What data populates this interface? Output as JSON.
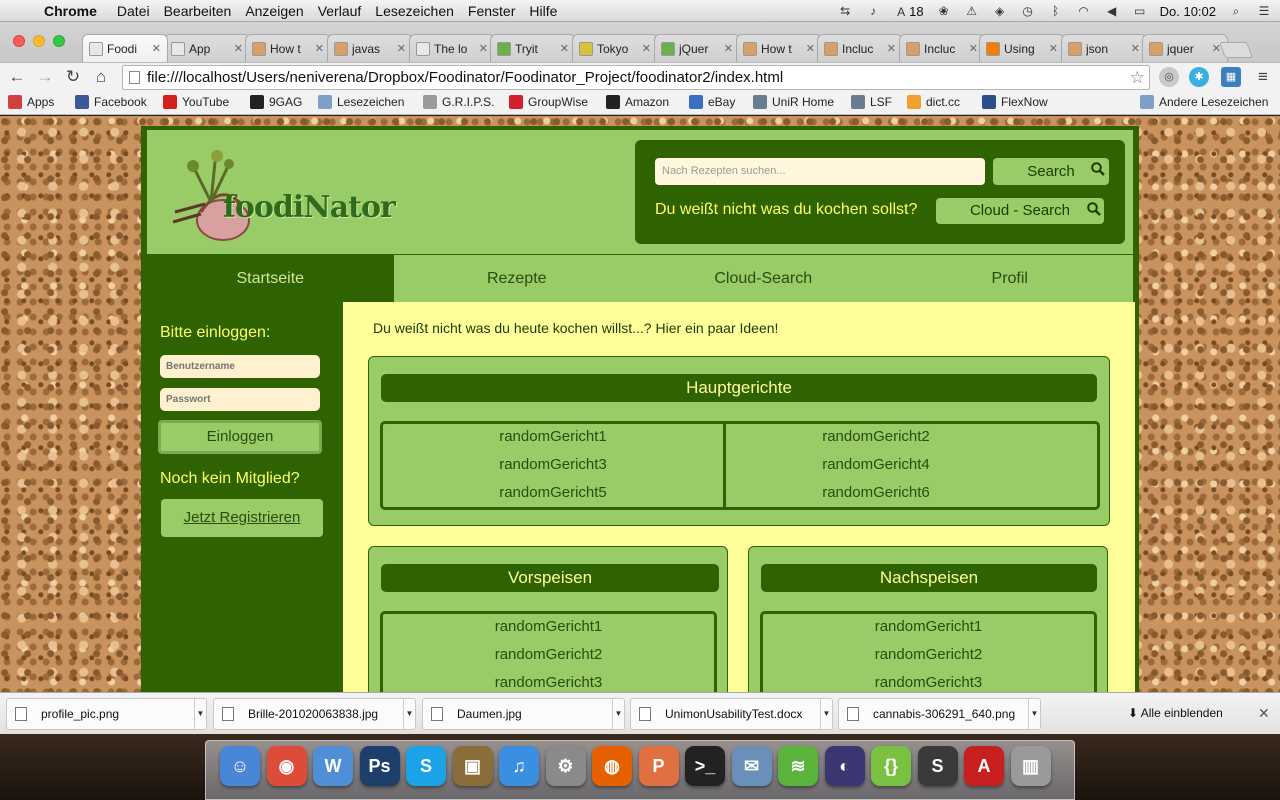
{
  "menubar": {
    "app_name": "Chrome",
    "menus": [
      "Datei",
      "Bearbeiten",
      "Anzeigen",
      "Verlauf",
      "Lesezeichen",
      "Fenster",
      "Hilfe"
    ],
    "status_18": "18",
    "clock": "Do. 10:02"
  },
  "tabs": [
    {
      "title": "Foodi",
      "favicon_color": "#e8e8e8",
      "active": true
    },
    {
      "title": "App",
      "favicon_color": "#e8e8e8"
    },
    {
      "title": "How t",
      "favicon_color": "#d9a066"
    },
    {
      "title": "javas",
      "favicon_color": "#d9a066"
    },
    {
      "title": "The lo",
      "favicon_color": "#e8e8e8"
    },
    {
      "title": "Tryit",
      "favicon_color": "#6ab04c"
    },
    {
      "title": "Tokyo",
      "favicon_color": "#d6c33a"
    },
    {
      "title": "jQuer",
      "favicon_color": "#6ab04c"
    },
    {
      "title": "How t",
      "favicon_color": "#d9a066"
    },
    {
      "title": "Incluc",
      "favicon_color": "#d9a066"
    },
    {
      "title": "Incluc",
      "favicon_color": "#d9a066"
    },
    {
      "title": "Using",
      "favicon_color": "#f57d00"
    },
    {
      "title": "json",
      "favicon_color": "#d9a066"
    },
    {
      "title": "jquer",
      "favicon_color": "#d9a066"
    }
  ],
  "toolbar": {
    "url": "file:///localhost/Users/neniverena/Dropbox/Foodinator/Foodinator_Project/foodinator2/index.html"
  },
  "bookmarks": [
    {
      "label": "Apps",
      "icon_color": "#d04040"
    },
    {
      "label": "Facebook",
      "icon_color": "#3b5998"
    },
    {
      "label": "YouTube",
      "icon_color": "#d62020"
    },
    {
      "label": "9GAG",
      "icon_color": "#222222"
    },
    {
      "label": "Lesezeichen",
      "icon_color": "#7d9fc8"
    },
    {
      "label": "G.R.I.P.S.",
      "icon_color": "#9a9a9a"
    },
    {
      "label": "GroupWise",
      "icon_color": "#d02030"
    },
    {
      "label": "Amazon",
      "icon_color": "#222222"
    },
    {
      "label": "eBay",
      "icon_color": "#3a6fc4"
    },
    {
      "label": "UniR Home",
      "icon_color": "#6a7d90"
    },
    {
      "label": "LSF",
      "icon_color": "#6a7d90"
    },
    {
      "label": "dict.cc",
      "icon_color": "#f0a030"
    },
    {
      "label": "FlexNow",
      "icon_color": "#2a4f8a"
    },
    {
      "label": "Andere Lesezeichen",
      "icon_color": "#7d9fc8"
    }
  ],
  "site": {
    "logo_text": "foodiNator",
    "search": {
      "placeholder": "Nach Rezepten suchen...",
      "button_label": "Search",
      "question": "Du weißt nicht was du kochen sollst?",
      "cloud_button_label": "Cloud - Search"
    },
    "nav": [
      "Startseite",
      "Rezepte",
      "Cloud-Search",
      "Profil"
    ],
    "sidebar": {
      "login_heading": "Bitte einloggen:",
      "username_placeholder": "Benutzername",
      "password_placeholder": "Passwort",
      "login_button": "Einloggen",
      "no_member": "Noch kein Mitglied?",
      "register_button": "Jetzt Registrieren"
    },
    "intro": "Du weißt nicht was du heute kochen willst...? Hier ein paar Ideen!",
    "main_dishes": {
      "title": "Hauptgerichte",
      "left": [
        "randomGericht1",
        "randomGericht3",
        "randomGericht5"
      ],
      "right": [
        "randomGericht2",
        "randomGericht4",
        "randomGericht6"
      ]
    },
    "starters": {
      "title": "Vorspeisen",
      "items": [
        "randomGericht1",
        "randomGericht2",
        "randomGericht3"
      ]
    },
    "desserts": {
      "title": "Nachspeisen",
      "items": [
        "randomGericht1",
        "randomGericht2",
        "randomGericht3"
      ]
    }
  },
  "downloads": {
    "items": [
      "profile_pic.png",
      "Brille-201020063838.jpg",
      "Daumen.jpg",
      "UnimonUsabilityTest.docx",
      "cannabis-306291_640.png"
    ],
    "show_all": "Alle einblenden"
  },
  "dock": {
    "apps": [
      {
        "name": "finder-icon",
        "color": "#4a86d8",
        "glyph": "☺"
      },
      {
        "name": "chrome-icon",
        "color": "#dd4b39",
        "glyph": "◉"
      },
      {
        "name": "word-icon",
        "color": "#4f8fd6",
        "glyph": "W"
      },
      {
        "name": "photoshop-icon",
        "color": "#1c3f6b",
        "glyph": "Ps"
      },
      {
        "name": "skype-icon",
        "color": "#1ba3e8",
        "glyph": "S"
      },
      {
        "name": "iphoto-icon",
        "color": "#8a6d3b",
        "glyph": "▣"
      },
      {
        "name": "itunes-icon",
        "color": "#3a8fe0",
        "glyph": "♫"
      },
      {
        "name": "system-preferences-icon",
        "color": "#8a8a8a",
        "glyph": "⚙"
      },
      {
        "name": "firefox-icon",
        "color": "#e66000",
        "glyph": "◍"
      },
      {
        "name": "presentation-icon",
        "color": "#e07040",
        "glyph": "P"
      },
      {
        "name": "terminal-icon",
        "color": "#222222",
        "glyph": ">_"
      },
      {
        "name": "mail-icon",
        "color": "#6a8fb8",
        "glyph": "✉"
      },
      {
        "name": "spotify-icon",
        "color": "#5ab33b",
        "glyph": "≋"
      },
      {
        "name": "eclipse-icon",
        "color": "#3b3572",
        "glyph": "◐"
      },
      {
        "name": "brackets-icon",
        "color": "#7ac142",
        "glyph": "{}"
      },
      {
        "name": "sublime-icon",
        "color": "#3a3a3a",
        "glyph": "S"
      },
      {
        "name": "acrobat-icon",
        "color": "#c8201e",
        "glyph": "A"
      },
      {
        "name": "trash-icon",
        "color": "#9a9a9a",
        "glyph": "▥"
      }
    ]
  }
}
